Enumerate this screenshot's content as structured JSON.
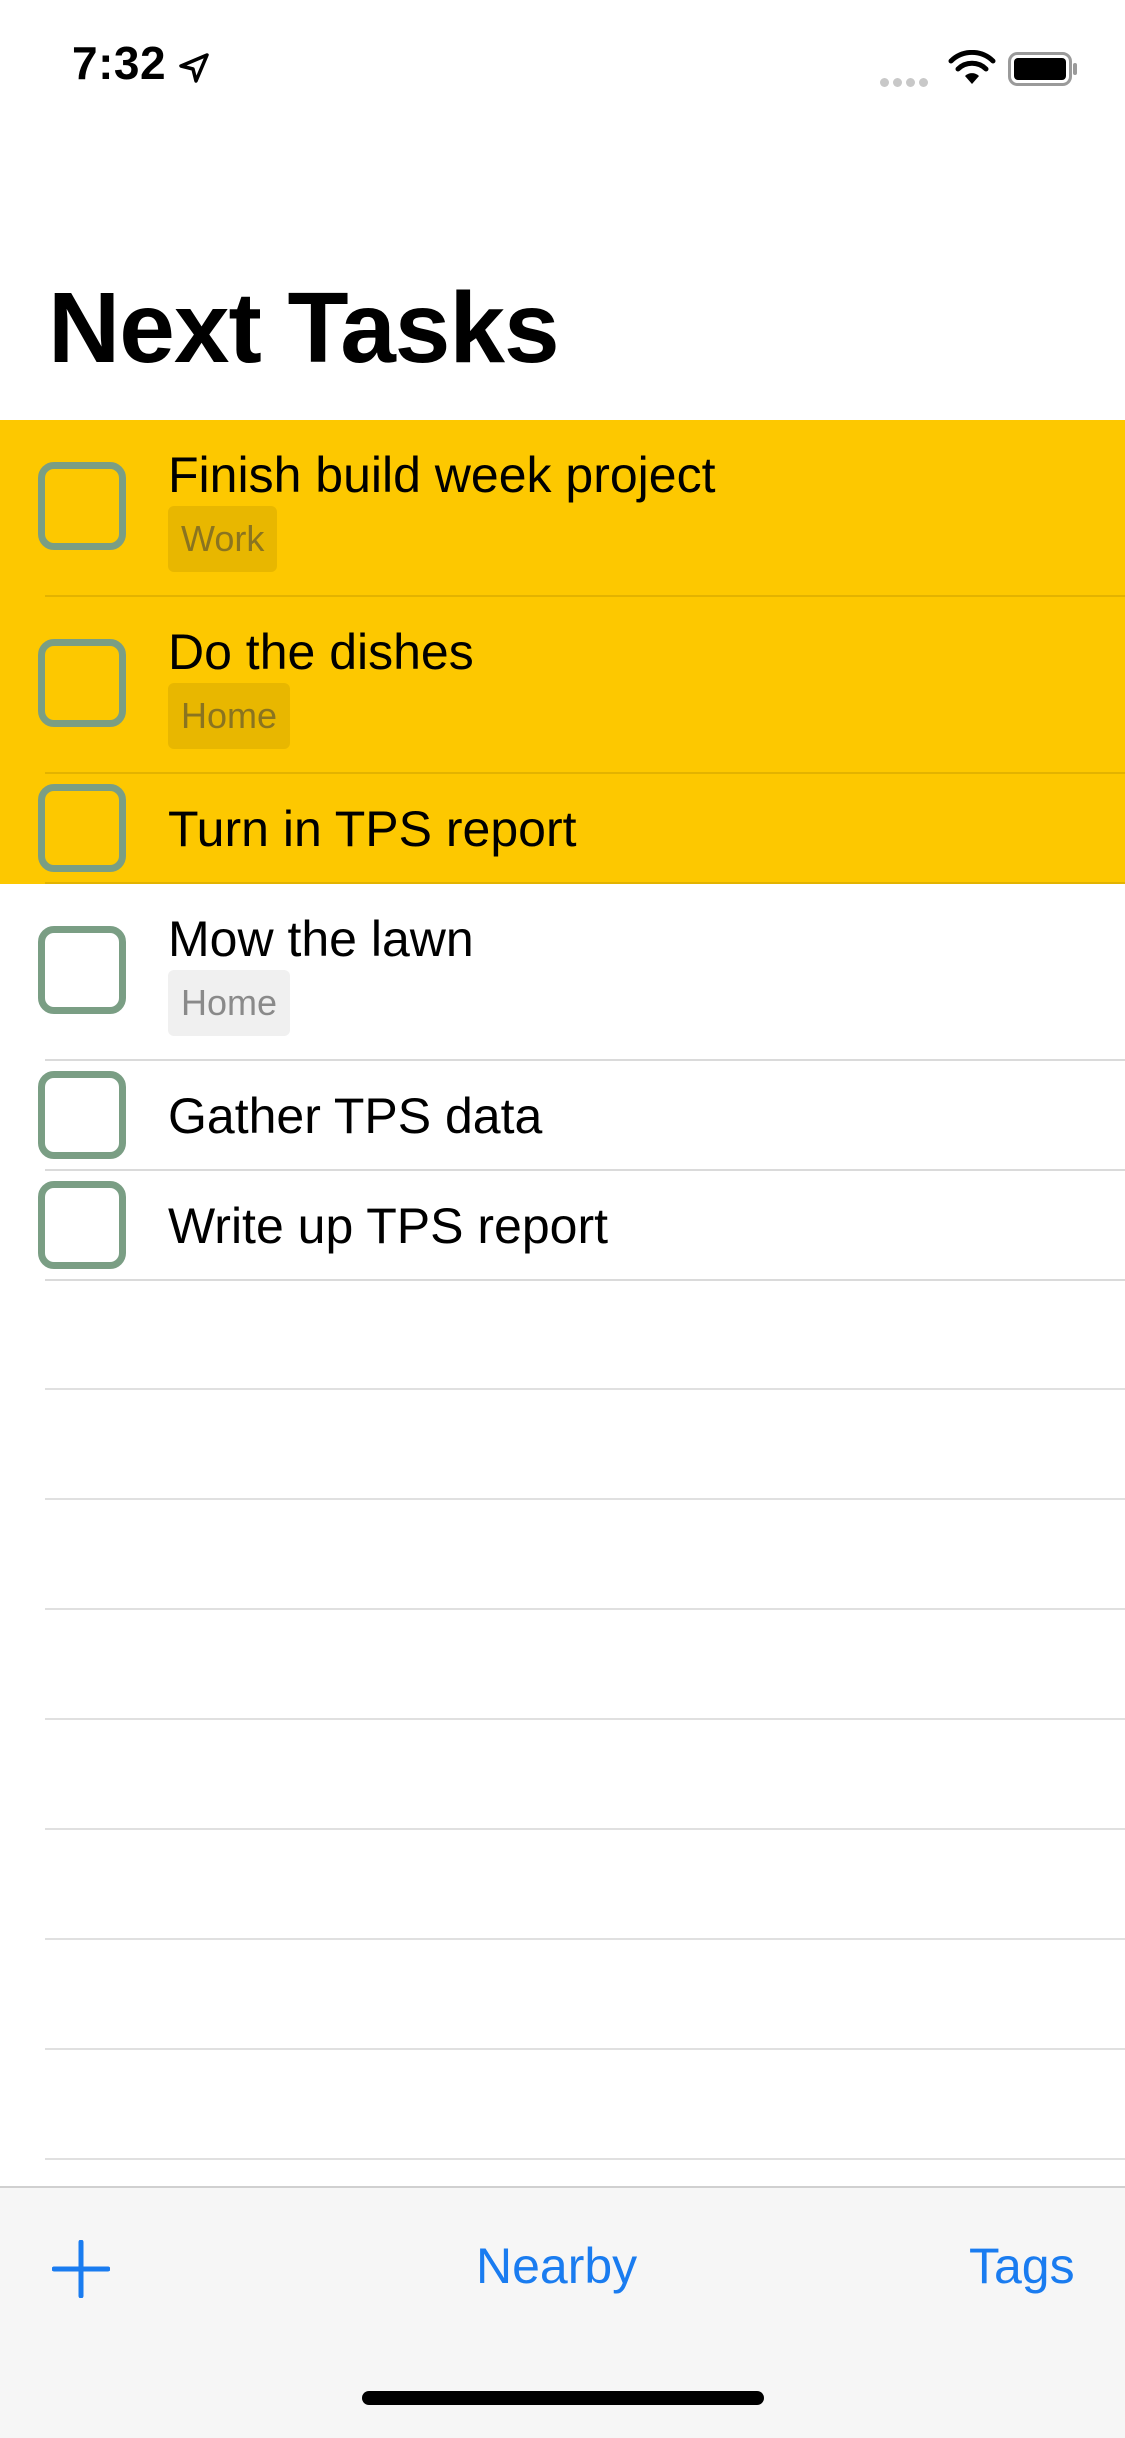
{
  "status_bar": {
    "time": "7:32",
    "icons": [
      "location-arrow-icon",
      "cellular-signal-icon",
      "wifi-icon",
      "battery-icon"
    ]
  },
  "page": {
    "title": "Next Tasks"
  },
  "tasks": [
    {
      "title": "Finish build week project",
      "tag": "Work",
      "highlighted": true,
      "completed": false
    },
    {
      "title": "Do the dishes",
      "tag": "Home",
      "highlighted": true,
      "completed": false
    },
    {
      "title": "Turn in TPS report",
      "tag": null,
      "highlighted": true,
      "completed": false
    },
    {
      "title": "Mow the lawn",
      "tag": "Home",
      "highlighted": false,
      "completed": false
    },
    {
      "title": "Gather TPS data",
      "tag": null,
      "highlighted": false,
      "completed": false
    },
    {
      "title": "Write up TPS report",
      "tag": null,
      "highlighted": false,
      "completed": false
    }
  ],
  "toolbar": {
    "add_icon": "plus-icon",
    "nearby_label": "Nearby",
    "tags_label": "Tags"
  },
  "colors": {
    "highlight": "#fdc800",
    "checkbox_border": "#7a9e84",
    "accent": "#1a7cf0"
  }
}
